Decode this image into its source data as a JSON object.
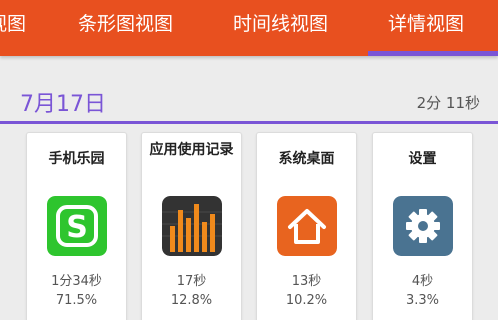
{
  "tabs": [
    {
      "label": "视图"
    },
    {
      "label": "条形图视图"
    },
    {
      "label": "时间线视图"
    },
    {
      "label": "详情视图"
    }
  ],
  "active_tab": 3,
  "day": {
    "date": "7月17日",
    "total": "2分 11秒"
  },
  "apps": [
    {
      "name": "手机乐园",
      "icon": "shopping-s-icon",
      "duration": "1分34秒",
      "percent": "71.5%",
      "icon_color": "#2ec52e"
    },
    {
      "name": "应用使用记录",
      "icon": "usage-bars-icon",
      "duration": "17秒",
      "percent": "12.8%",
      "icon_color": "#333333"
    },
    {
      "name": "系统桌面",
      "icon": "home-icon",
      "duration": "13秒",
      "percent": "10.2%",
      "icon_color": "#e8641f"
    },
    {
      "name": "设置",
      "icon": "gear-icon",
      "duration": "4秒",
      "percent": "3.3%",
      "icon_color": "#4a7391"
    }
  ],
  "colors": {
    "toolbar": "#e8501f",
    "accent": "#7a55d6",
    "background": "#ececec"
  }
}
